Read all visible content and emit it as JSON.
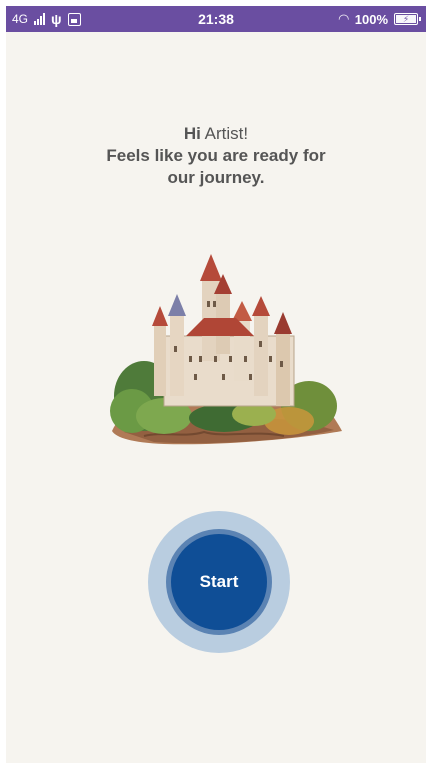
{
  "status_bar": {
    "network": "4G",
    "time": "21:38",
    "battery_percent": "100%",
    "icons": [
      "signal-icon",
      "usb-icon",
      "image-icon",
      "wifi-icon",
      "battery-icon"
    ],
    "background": "#6a4ea1"
  },
  "greeting": {
    "hi": "Hi",
    "name": "Artist!",
    "tagline": "Feels like you are ready for our journey."
  },
  "illustration": {
    "subject": "watercolor castle on rocky hill",
    "icon": "castle-illustration"
  },
  "start": {
    "label": "Start",
    "color": "#0f4e96"
  },
  "colors": {
    "background": "#f6f4ef",
    "text": "#555555"
  }
}
